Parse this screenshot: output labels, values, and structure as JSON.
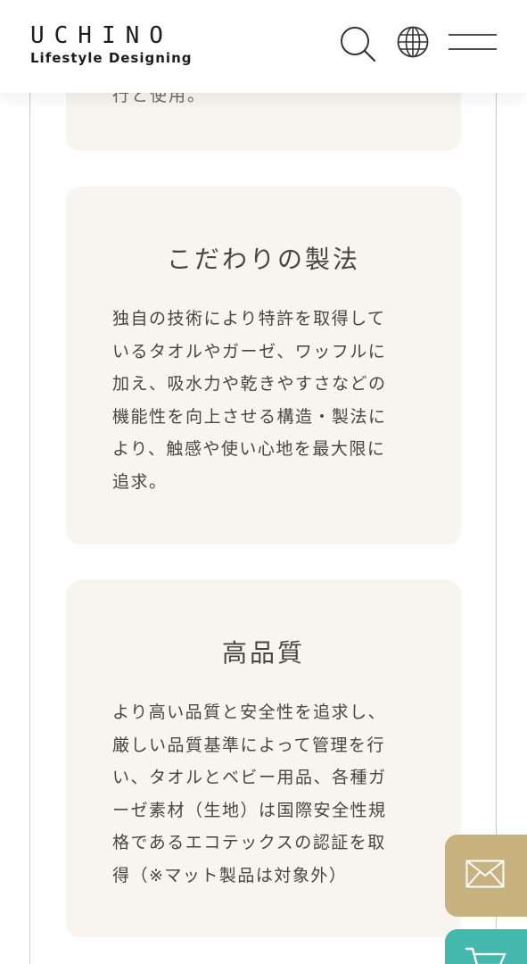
{
  "header": {
    "logo_main": "UCHINO",
    "logo_sub": "Lifestyle Designing",
    "icons": [
      "search-icon",
      "globe-icon",
      "hamburger-menu-icon"
    ]
  },
  "cards": {
    "top_partial_text": "行と使用。",
    "craft": {
      "title": "こだわりの製法",
      "lines": [
        "独自の技術により特許を取得して",
        "いるタオルやガーゼ、ワッフルに",
        "加え、吸水力や乾きやすさなどの",
        "機能性を向上させる構造・製法に",
        "より、触感や使い心地を最大限に",
        "追求。"
      ]
    },
    "quality": {
      "title": "高品質",
      "lines": [
        "より高い品質と安全性を追求し、",
        "厳しい品質基準によって管理を行",
        "い、タオルとベビー用品、各種ガ",
        "ーゼ素材（生地）は国際安全性規",
        "格であるエコテックスの認証を取",
        "得（※マット製品は対象外）"
      ]
    }
  },
  "floating": {
    "mail_icon": "mail-icon",
    "cart_icon": "cart-icon"
  },
  "colors": {
    "card_bg": "#f8f4ef",
    "mail_button": "#c8b27f",
    "cart_button": "#46b7ad",
    "text": "#4a4541"
  }
}
